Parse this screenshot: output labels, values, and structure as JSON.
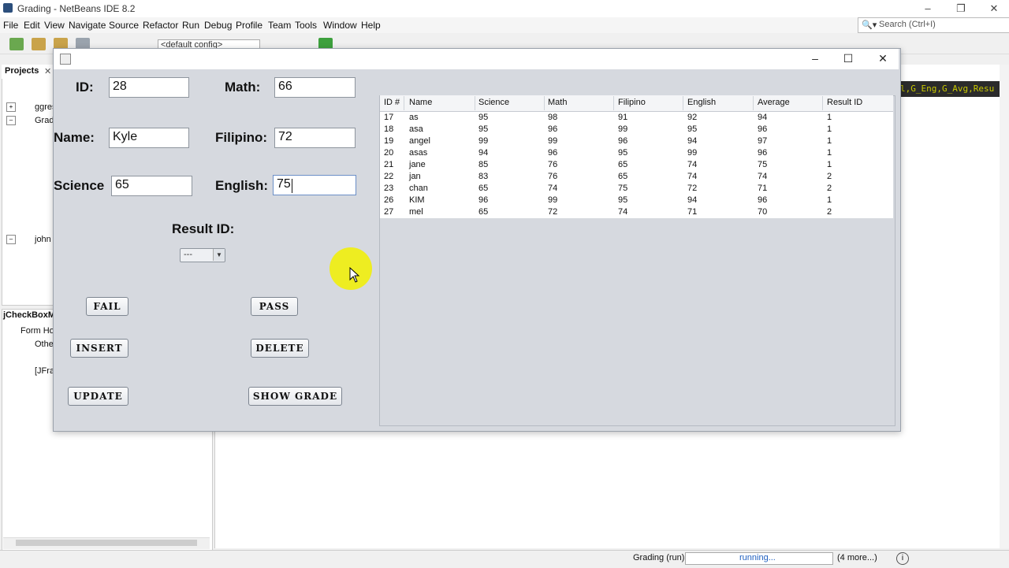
{
  "ide": {
    "title": "Grading - NetBeans IDE 8.2",
    "menu": [
      "File",
      "Edit",
      "View",
      "Navigate",
      "Source",
      "Refactor",
      "Run",
      "Debug",
      "Profile",
      "Team",
      "Tools",
      "Window",
      "Help"
    ],
    "search_placeholder": "Search (Ctrl+I)",
    "config": "<default config>",
    "projects_tab": "Projects",
    "tree": [
      "ggres",
      "Grad",
      "john"
    ],
    "navigator_tab": "jCheckBoxM",
    "navigator_items": [
      "Form Hom",
      "Othe",
      "[JFra"
    ],
    "code_snippet": "l,G_Eng,G_Avg,Resu",
    "status": {
      "run": "Grading (run)",
      "progress_text": "running...",
      "more": "(4 more...)"
    }
  },
  "form": {
    "labels": {
      "id": "ID:",
      "math": "Math:",
      "name": "Name:",
      "filipino": "Filipino:",
      "science": "Science",
      "english": "English:",
      "result_id": "Result ID:"
    },
    "fields": {
      "id": "28",
      "math": "66",
      "name": "Kyle",
      "filipino": "72",
      "science": "65",
      "english": "75"
    },
    "result_combo": "---",
    "buttons": {
      "fail": "FAIL",
      "pass": "PASS",
      "insert": "INSERT",
      "delete": "DELETE",
      "update": "UPDATE",
      "show_grade": "SHOW GRADE"
    }
  },
  "table": {
    "columns": [
      "ID #",
      "Name",
      "Science",
      "Math",
      "Filipino",
      "English",
      "Average",
      "Result ID"
    ],
    "rows": [
      [
        "17",
        "as",
        "95",
        "98",
        "91",
        "92",
        "94",
        "1"
      ],
      [
        "18",
        "asa",
        "95",
        "96",
        "99",
        "95",
        "96",
        "1"
      ],
      [
        "19",
        "angel",
        "99",
        "99",
        "96",
        "94",
        "97",
        "1"
      ],
      [
        "20",
        "asas",
        "94",
        "96",
        "95",
        "99",
        "96",
        "1"
      ],
      [
        "21",
        "jane",
        "85",
        "76",
        "65",
        "74",
        "75",
        "1"
      ],
      [
        "22",
        "jan",
        "83",
        "76",
        "65",
        "74",
        "74",
        "2"
      ],
      [
        "23",
        "chan",
        "65",
        "74",
        "75",
        "72",
        "71",
        "2"
      ],
      [
        "26",
        "KIM",
        "96",
        "99",
        "95",
        "94",
        "96",
        "1"
      ],
      [
        "27",
        "mel",
        "65",
        "72",
        "74",
        "71",
        "70",
        "2"
      ]
    ]
  }
}
